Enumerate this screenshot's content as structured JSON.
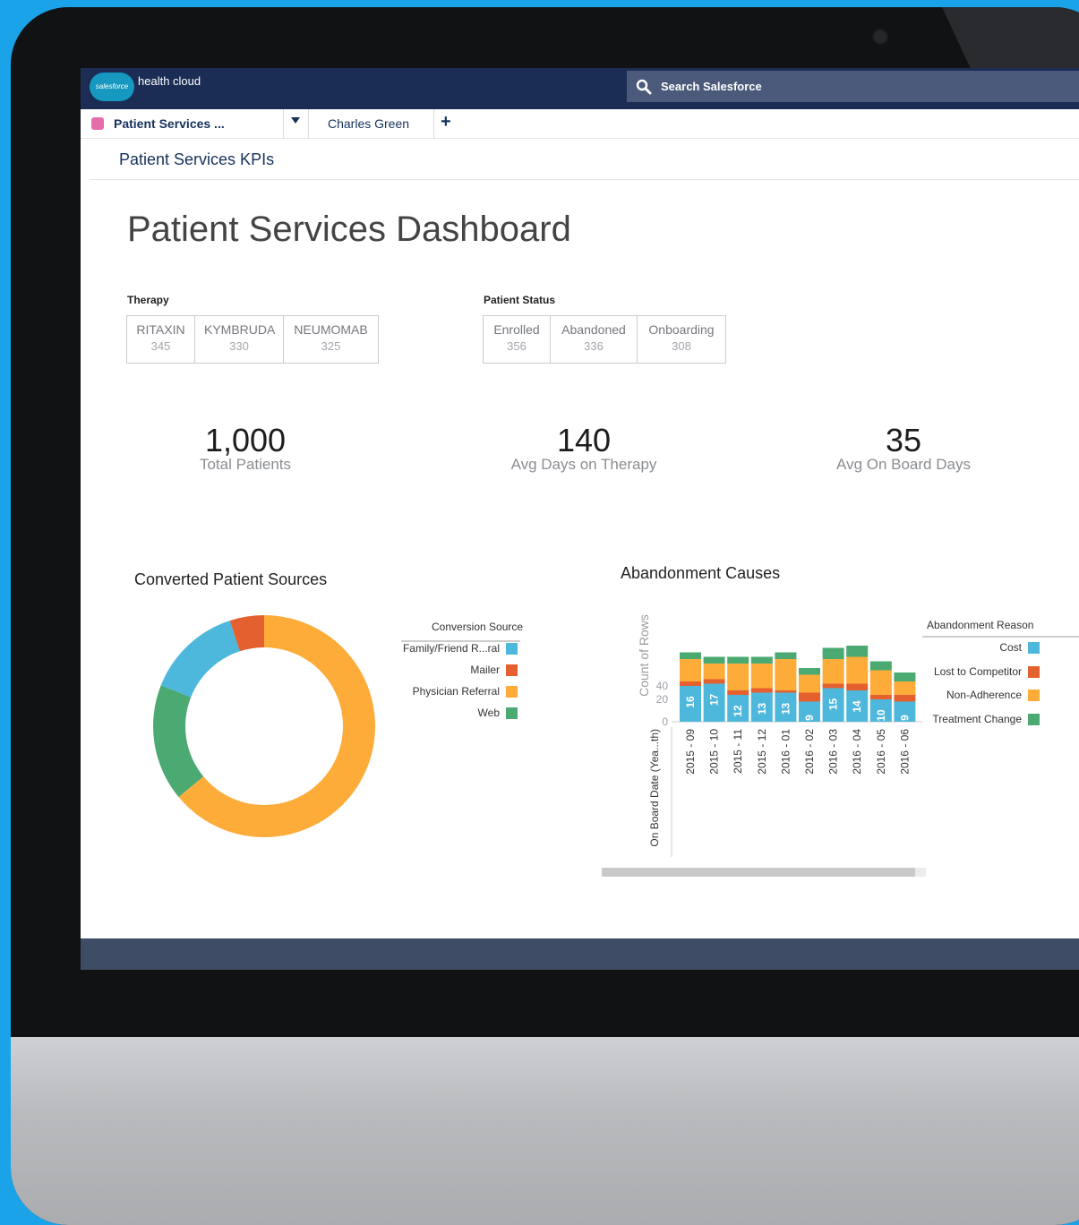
{
  "app": {
    "logo_text": "salesforce",
    "name": "health cloud"
  },
  "search": {
    "placeholder": "Search Salesforce"
  },
  "tabs": [
    {
      "label": "Patient Services ..."
    },
    {
      "label": "Charles Green"
    }
  ],
  "subheader": "Patient Services KPIs",
  "page_title": "Patient Services Dashboard",
  "filters": {
    "therapy": {
      "label": "Therapy",
      "options": [
        {
          "name": "RITAXIN",
          "count": "345"
        },
        {
          "name": "KYMBRUDA",
          "count": "330"
        },
        {
          "name": "NEUMOMAB",
          "count": "325"
        }
      ]
    },
    "status": {
      "label": "Patient Status",
      "options": [
        {
          "name": "Enrolled",
          "count": "356"
        },
        {
          "name": "Abandoned",
          "count": "336"
        },
        {
          "name": "Onboarding",
          "count": "308"
        }
      ]
    }
  },
  "kpis": [
    {
      "value": "1,000",
      "label": "Total Patients"
    },
    {
      "value": "140",
      "label": "Avg Days on Therapy"
    },
    {
      "value": "35",
      "label": "Avg On Board Days"
    }
  ],
  "colors": {
    "cost": "#4eb8dc",
    "competitor": "#e4602f",
    "nonadherence": "#fdac3a",
    "treatment": "#4aaa71"
  },
  "chart_data": [
    {
      "type": "pie",
      "title": "Converted Patient Sources",
      "legend_title": "Conversion Source",
      "legend_position": "right",
      "categories": [
        "Family/Friend R...ral",
        "Mailer",
        "Physician Referral",
        "Web"
      ],
      "values": [
        14,
        5,
        64,
        17
      ]
    },
    {
      "type": "bar",
      "stacked": true,
      "title": "Abandonment Causes",
      "ylabel": "Count of Rows",
      "xlabel": "On Board Date (Yea...th)",
      "legend_title": "Abandonment Reason",
      "legend_position": "right",
      "y_ticks": [
        "0",
        "20",
        "40"
      ],
      "categories": [
        "2015 - 09",
        "2015 - 10",
        "2015 - 11",
        "2015 - 12",
        "2016 - 01",
        "2016 - 02",
        "2016 - 03",
        "2016 - 04",
        "2016 - 05",
        "2016 - 06"
      ],
      "series": [
        {
          "name": "Cost",
          "values": [
            16,
            17,
            12,
            13,
            13,
            9,
            15,
            14,
            10,
            9
          ]
        },
        {
          "name": "Lost to Competitor",
          "values": [
            2,
            2,
            2,
            2,
            1,
            4,
            2,
            3,
            2,
            3
          ]
        },
        {
          "name": "Non-Adherence",
          "values": [
            10,
            7,
            12,
            11,
            14,
            8,
            11,
            12,
            11,
            6
          ]
        },
        {
          "name": "Treatment Change",
          "values": [
            3,
            3,
            3,
            3,
            3,
            3,
            5,
            5,
            4,
            4
          ]
        }
      ]
    }
  ]
}
